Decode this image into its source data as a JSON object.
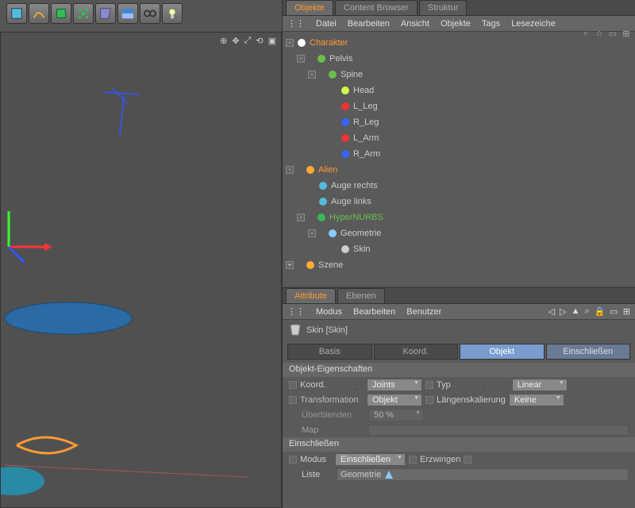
{
  "toolbar_icons": [
    "cube",
    "snake",
    "cube-green",
    "flower",
    "wedge",
    "grid",
    "goggles",
    "bulb"
  ],
  "obj_tabs": [
    {
      "label": "Objekte",
      "active": true
    },
    {
      "label": "Content Browser",
      "active": false
    },
    {
      "label": "Struktur",
      "active": false
    }
  ],
  "obj_menu": [
    "Datei",
    "Bearbeiten",
    "Ansicht",
    "Objekte",
    "Tags",
    "Lesezeiche"
  ],
  "tree": [
    {
      "indent": 0,
      "exp": "-",
      "label": "Charakter",
      "cls": "orange",
      "dots": true,
      "chk": true
    },
    {
      "indent": 1,
      "exp": "-",
      "label": "Pelvis",
      "cls": "",
      "dots": true
    },
    {
      "indent": 2,
      "exp": "-",
      "label": "Spine",
      "cls": "",
      "dots": true
    },
    {
      "indent": 3,
      "exp": "",
      "label": "Head",
      "cls": "",
      "dots": true
    },
    {
      "indent": 3,
      "exp": "",
      "label": "L_Leg",
      "cls": "",
      "dots": true
    },
    {
      "indent": 3,
      "exp": "",
      "label": "R_Leg",
      "cls": "",
      "dots": true
    },
    {
      "indent": 3,
      "exp": "",
      "label": "L_Arm",
      "cls": "",
      "dots": true
    },
    {
      "indent": 3,
      "exp": "",
      "label": "R_Arm",
      "cls": "",
      "dots": true
    },
    {
      "indent": 0,
      "exp": "-",
      "label": "Alien",
      "cls": "orange",
      "dots": true,
      "chk": true
    },
    {
      "indent": 1,
      "exp": "",
      "label": "Auge rechts",
      "cls": "",
      "dots": true,
      "chk": true,
      "tags": "eye"
    },
    {
      "indent": 1,
      "exp": "",
      "label": "Auge links",
      "cls": "",
      "dots": true,
      "chk": true,
      "tags": "eye"
    },
    {
      "indent": 1,
      "exp": "-",
      "label": "HyperNURBS",
      "cls": "green",
      "dots": true,
      "chk": true
    },
    {
      "indent": 2,
      "exp": "-",
      "label": "Geometrie",
      "cls": "",
      "dots": true,
      "tags": "geo"
    },
    {
      "indent": 3,
      "exp": "",
      "label": "Skin",
      "cls": "",
      "dots": true,
      "chk": true
    },
    {
      "indent": 0,
      "exp": "+",
      "label": "Szene",
      "cls": "",
      "dots": true
    }
  ],
  "attr_tabs": [
    {
      "label": "Attribute",
      "active": true
    },
    {
      "label": "Ebenen",
      "active": false
    }
  ],
  "attr_menu": [
    "Modus",
    "Bearbeiten",
    "Benutzer"
  ],
  "skin_title": "Skin [Skin]",
  "subtabs": [
    {
      "label": "Basis",
      "cls": ""
    },
    {
      "label": "Koord.",
      "cls": ""
    },
    {
      "label": "Objekt",
      "cls": "active"
    },
    {
      "label": "Einschließen",
      "cls": "semi"
    }
  ],
  "section1": "Objekt-Eigenschaften",
  "props": {
    "koord_lbl": "Koord.",
    "koord_val": "Joints",
    "typ_lbl": "Typ",
    "typ_val": "Linear",
    "trans_lbl": "Transformation",
    "trans_val": "Objekt",
    "langs_lbl": "Längenskalierung",
    "langs_val": "Keine",
    "ueber_lbl": "Überblenden",
    "ueber_val": "50 %",
    "map_lbl": "Map"
  },
  "section2": "Einschließen",
  "inc": {
    "modus_lbl": "Modus",
    "modus_val": "Einschließen",
    "erz_lbl": "Erzwingen",
    "liste_lbl": "Liste",
    "liste_val": "Geometrie"
  }
}
